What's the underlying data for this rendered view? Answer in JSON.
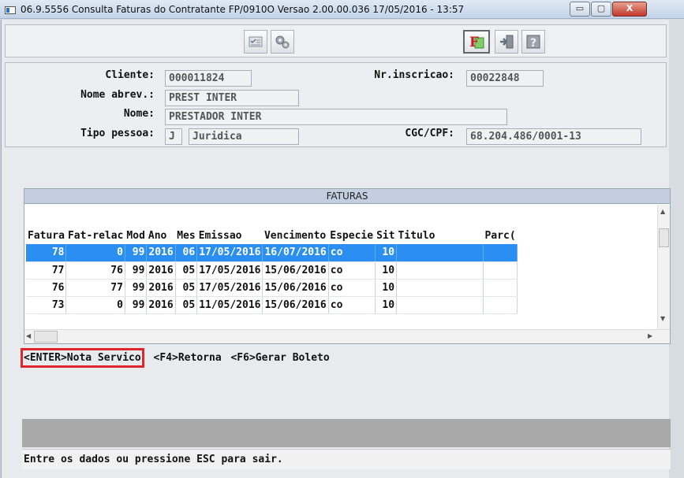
{
  "window": {
    "title": "06.9.5556 Consulta Faturas do Contratante FP/0910O Versao 2.00.00.036 17/05/2016 - 13:57",
    "min_glyph": "▭",
    "max_glyph": "▢",
    "close_glyph": "X"
  },
  "toolbar": {
    "icons": [
      "select-icon",
      "config-icon",
      "filter-f-icon",
      "exit-icon",
      "help-icon"
    ]
  },
  "header": {
    "cliente_label": "Cliente:",
    "cliente_value": "000011824",
    "nr_inscricao_label": "Nr.inscricao:",
    "nr_inscricao_value": "00022848",
    "nome_abrev_label": "Nome abrev.:",
    "nome_abrev_value": "PREST INTER",
    "nome_label": "Nome:",
    "nome_value": "PRESTADOR INTER",
    "tipo_pessoa_label": "Tipo pessoa:",
    "tipo_pessoa_code": "J",
    "tipo_pessoa_desc": "Juridica",
    "cgc_label": "CGC/CPF:",
    "cgc_value": "68.204.486/0001-13"
  },
  "grid": {
    "title": "FATURAS",
    "columns": [
      "Fatura",
      "Fat-relac",
      "Mod",
      "Ano",
      "Mes",
      "Emissao",
      "Vencimento",
      "Especie",
      "Sit",
      "Titulo",
      "Parc("
    ],
    "rows": [
      [
        "78",
        "0",
        "99",
        "2016",
        "06",
        "17/05/2016",
        "16/07/2016",
        "co",
        "10",
        "",
        ""
      ],
      [
        "77",
        "76",
        "99",
        "2016",
        "05",
        "17/05/2016",
        "15/06/2016",
        "co",
        "10",
        "",
        ""
      ],
      [
        "76",
        "77",
        "99",
        "2016",
        "05",
        "17/05/2016",
        "15/06/2016",
        "co",
        "10",
        "",
        ""
      ],
      [
        "73",
        "0",
        "99",
        "2016",
        "05",
        "11/05/2016",
        "15/06/2016",
        "co",
        "10",
        "",
        ""
      ]
    ],
    "selected_row": 0
  },
  "function_keys": {
    "enter": "<ENTER>Nota Servico",
    "f4": "<F4>Retorna",
    "f6": "<F6>Gerar Boleto"
  },
  "status": {
    "text": "Entre os dados ou pressione ESC para sair."
  },
  "colors": {
    "selection": "#2a8ff0",
    "highlight_border": "#e0262f",
    "grid_title_bg": "#c3cfe0"
  }
}
